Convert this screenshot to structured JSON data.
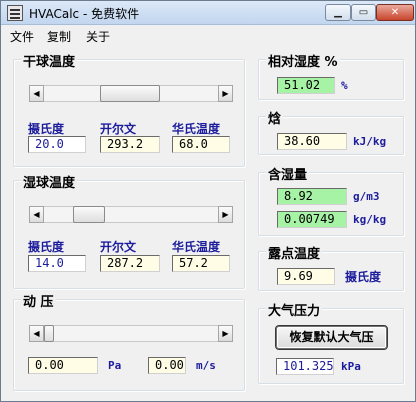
{
  "window": {
    "title": "HVACalc - 免费软件",
    "min_glyph": "▁",
    "max_glyph": "▭",
    "close_glyph": "✕"
  },
  "menu": [
    "文件",
    "复制",
    "关于"
  ],
  "dry_bulb": {
    "title": "干球温度",
    "slider_fraction": 0.5,
    "left_arrow": "◀",
    "right_arrow": "▶",
    "labels": {
      "celsius": "摄氏度",
      "kelvin": "开尔文",
      "fahrenheit": "华氏温度"
    },
    "values": {
      "celsius": "20.0",
      "kelvin": "293.2",
      "fahrenheit": "68.0"
    }
  },
  "wet_bulb": {
    "title": "湿球温度",
    "slider_fraction": 0.3,
    "left_arrow": "◀",
    "right_arrow": "▶",
    "labels": {
      "celsius": "摄氏度",
      "kelvin": "开尔文",
      "fahrenheit": "华氏温度"
    },
    "values": {
      "celsius": "14.0",
      "kelvin": "287.2",
      "fahrenheit": "57.2"
    }
  },
  "dynamic_pressure": {
    "title": "动 压",
    "slider_fraction": 0.0,
    "left_arrow": "◀",
    "right_arrow": "▶",
    "pa_value": "0.00",
    "pa_unit": "Pa",
    "ms_value": "0.00",
    "ms_unit": "m/s"
  },
  "relative_humidity": {
    "title": "相对湿度 %",
    "value": "51.02",
    "unit": "%"
  },
  "enthalpy": {
    "title": "焓",
    "value": "38.60",
    "unit": "kJ/kg"
  },
  "moisture": {
    "title": "含湿量",
    "value_g": "8.92",
    "unit_g": "g/m3",
    "value_kg": "0.00749",
    "unit_kg": "kg/kg"
  },
  "dew_point": {
    "title": "露点温度",
    "value": "9.69",
    "unit": "摄氏度"
  },
  "atmospheric": {
    "title": "大气压力",
    "reset_label": "恢复默认大气压",
    "value": "101.325",
    "unit": "kPa"
  },
  "colors": {
    "field_green": "#a6f3a6",
    "field_cream": "#fffde6",
    "label_blue": "#1c1c9c"
  }
}
